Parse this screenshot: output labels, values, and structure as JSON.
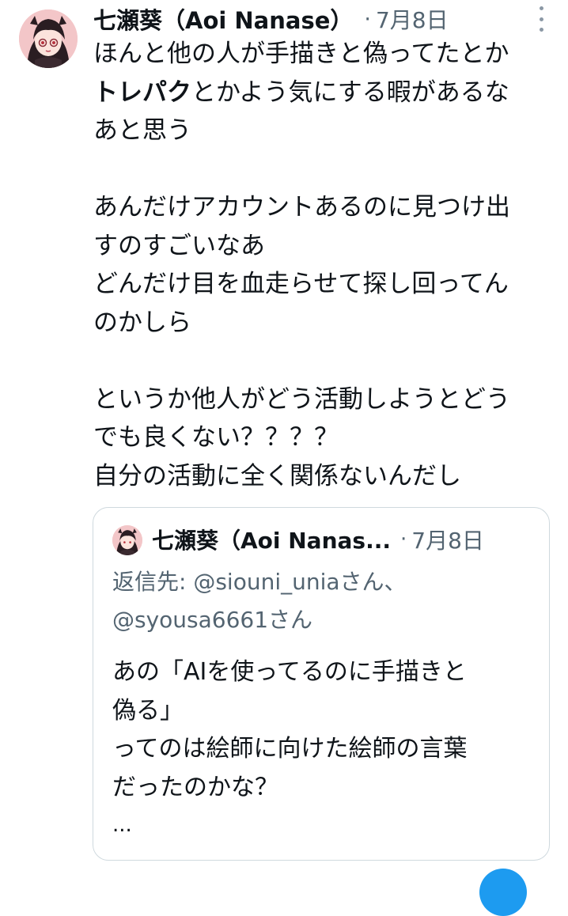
{
  "tweet": {
    "author_name": "七瀬葵（Aoi Nanase）",
    "separator": "·",
    "date": "7月8日",
    "lines": [
      [
        {
          "text": "ほんと他の人が手描きと偽ってたとか",
          "bold": false
        }
      ],
      [
        {
          "text": "トレパク",
          "bold": true
        },
        {
          "text": "とかよう気にする暇があるな",
          "bold": false
        }
      ],
      [
        {
          "text": "あと思う",
          "bold": false
        }
      ],
      [
        {
          "text": "",
          "bold": false
        }
      ],
      [
        {
          "text": "あんだけアカウントあるのに見つけ出",
          "bold": false
        }
      ],
      [
        {
          "text": "すのすごいなあ",
          "bold": false
        }
      ],
      [
        {
          "text": "どんだけ目を血走らせて探し回ってん",
          "bold": false
        }
      ],
      [
        {
          "text": "のかしら",
          "bold": false
        }
      ],
      [
        {
          "text": "",
          "bold": false
        }
      ],
      [
        {
          "text": "というか他人がどう活動しようとどう",
          "bold": false
        }
      ],
      [
        {
          "text": "でも良くない？？？？",
          "bold": false
        }
      ],
      [
        {
          "text": "自分の活動に全く関係ないんだし",
          "bold": false
        }
      ]
    ]
  },
  "quoted": {
    "author_name": "七瀬葵（Aoi Nanas...",
    "separator": "·",
    "date": "7月8日",
    "reply_lines": [
      "返信先: @siouni_uniaさん、",
      "@syousa6661さん"
    ],
    "body_lines": [
      "あの「AIを使ってるのに手描きと",
      "偽る」",
      "ってのは絵師に向けた絵師の言葉",
      "だったのかな？"
    ],
    "ellipsis": "..."
  },
  "colors": {
    "text": "#0f1419",
    "muted": "#536471",
    "border": "#cfd9de",
    "accent": "#1d9bf0"
  },
  "icons": {
    "more": "more-dots-icon",
    "avatar": "avatar-anime-girl"
  }
}
